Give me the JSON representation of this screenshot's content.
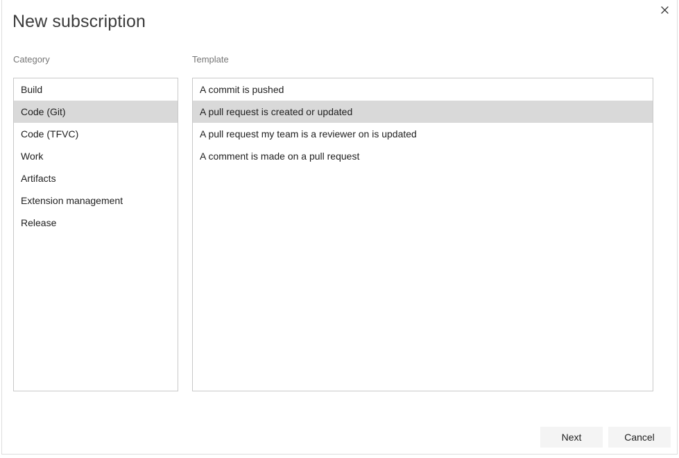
{
  "dialog": {
    "title": "New subscription",
    "close_icon": "close-icon"
  },
  "category": {
    "label": "Category",
    "items": [
      {
        "label": "Build",
        "selected": false
      },
      {
        "label": "Code (Git)",
        "selected": true
      },
      {
        "label": "Code (TFVC)",
        "selected": false
      },
      {
        "label": "Work",
        "selected": false
      },
      {
        "label": "Artifacts",
        "selected": false
      },
      {
        "label": "Extension management",
        "selected": false
      },
      {
        "label": "Release",
        "selected": false
      }
    ]
  },
  "template": {
    "label": "Template",
    "items": [
      {
        "label": "A commit is pushed",
        "selected": false
      },
      {
        "label": "A pull request is created or updated",
        "selected": true
      },
      {
        "label": "A pull request my team is a reviewer on is updated",
        "selected": false
      },
      {
        "label": "A comment is made on a pull request",
        "selected": false
      }
    ]
  },
  "footer": {
    "next_label": "Next",
    "cancel_label": "Cancel"
  },
  "colors": {
    "selection": "#d9d9d9",
    "border": "#c8c8c8",
    "button_bg": "#f4f4f4",
    "label": "#757575",
    "text": "#1e1e1e"
  }
}
